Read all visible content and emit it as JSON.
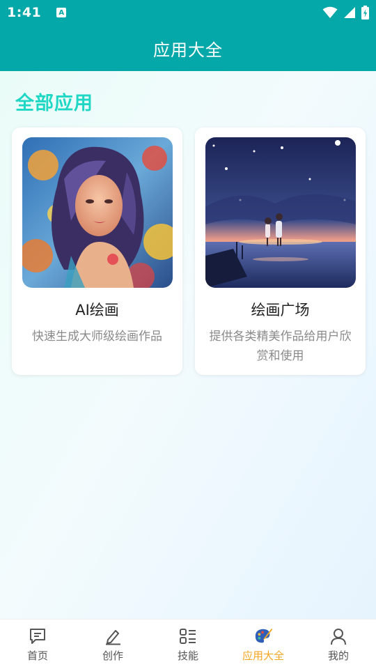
{
  "status_bar": {
    "time": "1:41",
    "notif_glyph": "A"
  },
  "header": {
    "title": "应用大全"
  },
  "section": {
    "title": "全部应用"
  },
  "apps": [
    {
      "title": "AI绘画",
      "description": "快速生成大师级绘画作品",
      "image": "colorful-woman-portrait"
    },
    {
      "title": "绘画广场",
      "description": "提供各类精美作品给用户欣赏和使用",
      "image": "couple-seaside-night"
    }
  ],
  "tabs": [
    {
      "label": "首页",
      "icon": "message-icon",
      "active": false
    },
    {
      "label": "创作",
      "icon": "pen-icon",
      "active": false
    },
    {
      "label": "技能",
      "icon": "grid-list-icon",
      "active": false
    },
    {
      "label": "应用大全",
      "icon": "palette-icon",
      "active": true
    },
    {
      "label": "我的",
      "icon": "user-icon",
      "active": false
    }
  ],
  "colors": {
    "primary": "#05a8a8",
    "accent_title": "#1fd7c4",
    "active_tab": "#f5a623"
  }
}
